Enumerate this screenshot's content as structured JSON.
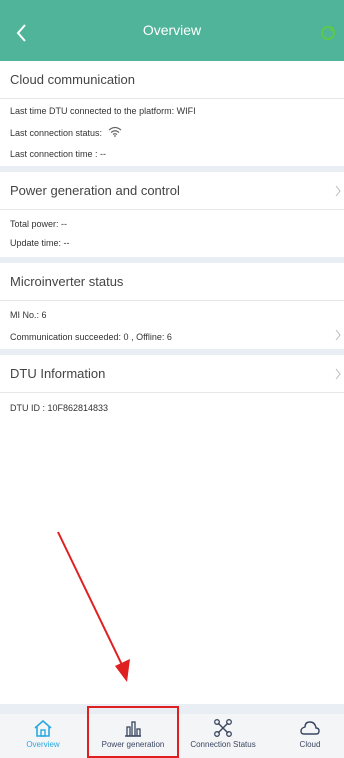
{
  "header": {
    "title": "Overview",
    "back_icon": "chevron-left-icon",
    "right_icon": "refresh-icon"
  },
  "cloud": {
    "title": "Cloud communication",
    "last_connected": "Last time DTU connected to the platform: WIFI",
    "status_label": "Last connection status:",
    "status_icon": "wifi-icon",
    "last_time": "Last connection time : --"
  },
  "power": {
    "title": "Power generation and control",
    "total": "Total power: --",
    "update": "Update time: --"
  },
  "micro": {
    "title": "Microinverter status",
    "mi_no": "MI No.: 6",
    "comm": "Communication succeeded: 0 , Offline: 6"
  },
  "dtu": {
    "title": "DTU Information",
    "id": "DTU ID : 10F862814833"
  },
  "tabs": [
    {
      "label": "Overview",
      "icon": "home-icon",
      "active": true
    },
    {
      "label": "Power generation",
      "icon": "bar-chart-icon",
      "active": false
    },
    {
      "label": "Connection Status",
      "icon": "network-icon",
      "active": false
    },
    {
      "label": "Cloud",
      "icon": "cloud-icon",
      "active": false
    }
  ],
  "colors": {
    "header_bg": "#4fb49a",
    "active_tab": "#2aa9e0",
    "inactive_tab": "#3a4660",
    "annotation": "#e02020",
    "separator": "#e9eef5"
  }
}
